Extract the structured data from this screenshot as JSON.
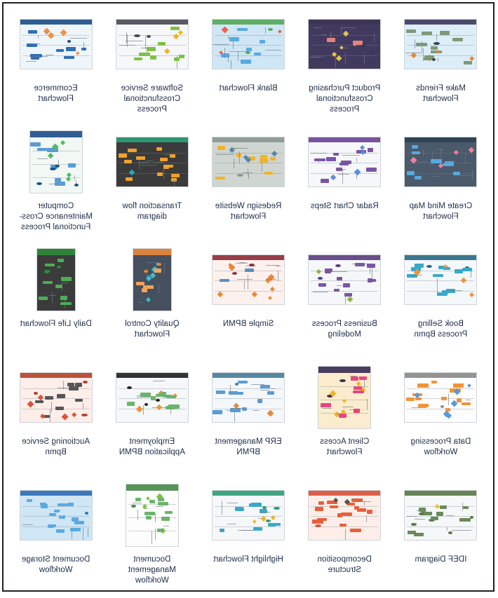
{
  "gallery": {
    "columns": 5,
    "rows": 5,
    "label_color": "#1b2a47",
    "border_color": "#231f20",
    "templates": [
      {
        "id": "make-friends-flowchart",
        "label": "Make Friends Flowchart",
        "shape": "landscape",
        "bg": "bg-lightblue",
        "accent": "#7e9a77",
        "accent2": "#e8893a",
        "dark": "#3f3a5e"
      },
      {
        "id": "product-purchasing-crossfunctional",
        "label": "Product Purchasing Crossfunctional Process",
        "shape": "landscape",
        "bg": "bg-navy",
        "accent": "#e8837a",
        "accent2": "#e8c44a",
        "dark": "#3a3456"
      },
      {
        "id": "blank-flowchart",
        "label": "Blank Flowchart",
        "shape": "landscape",
        "bg": "bg-skyblue",
        "accent": "#5aa9e0",
        "accent2": "#e8634a",
        "dark": "#57a85b"
      },
      {
        "id": "software-service-crossfunctional",
        "label": "Software Service Crossfunctional Process",
        "shape": "landscape",
        "bg": "bg-offwhite",
        "accent": "#7dc242",
        "accent2": "#f0b429",
        "dark": "#4b4b57"
      },
      {
        "id": "ecommerce-flowchart",
        "label": "Ecommerce Flowchart",
        "shape": "landscape",
        "bg": "bg-paleblue",
        "accent": "#2f6fb5",
        "accent2": "#f0924a",
        "dark": "#1e4f87"
      },
      {
        "id": "create-mind-map-flowchart",
        "label": "Create Mind Map Flowchart",
        "shape": "landscape",
        "bg": "bg-slate",
        "accent": "#58a8dd",
        "accent2": "#ef7ea0",
        "dark": "#2f4255"
      },
      {
        "id": "radar-chart-steps",
        "label": "Radar Chart Steps",
        "shape": "landscape",
        "bg": "bg-offwhite",
        "accent": "#7b55a3",
        "accent2": "#5c8fd6",
        "dark": "#6a4596"
      },
      {
        "id": "redesign-website-flowchart",
        "label": "Redesign Website Flowchart",
        "shape": "landscape",
        "bg": "bg-grey",
        "accent": "#f0b429",
        "accent2": "#5a86a8",
        "dark": "#8a9a92"
      },
      {
        "id": "transaction-flow-diagram",
        "label": "Transaction flow diagram",
        "shape": "landscape",
        "bg": "bg-dark",
        "accent": "#f0a32a",
        "accent2": "#2fa5c0",
        "dark": "#2f9e78"
      },
      {
        "id": "computer-maintenance-crossfunctional",
        "label": "Computer Maintenance Cross-Functional Process",
        "shape": "tallish",
        "bg": "bg-mint",
        "accent": "#5a9bd5",
        "accent2": "#52b86a",
        "dark": "#1f4f8a"
      },
      {
        "id": "book-selling-process-bpmn",
        "label": "Book Selling Process Bpmn",
        "shape": "landscape",
        "bg": "bg-ice",
        "accent": "#3aa8c8",
        "accent2": "#f0943a",
        "dark": "#2a6c86"
      },
      {
        "id": "business-process-modeling",
        "label": "Business Process Modeling",
        "shape": "landscape",
        "bg": "bg-offwhite",
        "accent": "#7b55a3",
        "accent2": "#8cb63a",
        "dark": "#5d3f80"
      },
      {
        "id": "simple-bpmn",
        "label": "Simple BPMN",
        "shape": "landscape",
        "bg": "bg-palepink",
        "accent": "#5a8ec0",
        "accent2": "#e8893a",
        "dark": "#8f2f3a"
      },
      {
        "id": "quality-control-flowchart",
        "label": "Quality Control Flowchart",
        "shape": "portrait",
        "bg": "bg-darkslate",
        "accent": "#f0a356",
        "accent2": "#3fbecf",
        "dark": "#e8883a"
      },
      {
        "id": "daily-life-flowchart",
        "label": "Daily Life Flowchart",
        "shape": "portrait",
        "bg": "bg-dark",
        "accent": "#4cae53",
        "accent2": "#cfcfcf",
        "dark": "#2f8a3a"
      },
      {
        "id": "data-processing-workflow",
        "label": "Data Processing Workflow",
        "shape": "landscape",
        "bg": "bg-white",
        "accent": "#f0943a",
        "accent2": "#5a9bd5",
        "dark": "#8a8a8a"
      },
      {
        "id": "client-access-flowchart",
        "label": "Client Access Flowchart",
        "shape": "tallish",
        "bg": "bg-cream",
        "accent": "#e8457e",
        "accent2": "#f0b429",
        "dark": "#3a2f56"
      },
      {
        "id": "erp-management-bpmn",
        "label": "ERP Management BPMN",
        "shape": "landscape",
        "bg": "bg-ice",
        "accent": "#5a9bd5",
        "accent2": "#e8893a",
        "dark": "#4a7f9a"
      },
      {
        "id": "employment-application-bpmn",
        "label": "Employment Application BPMN",
        "shape": "landscape",
        "bg": "bg-offwhite",
        "accent": "#6cb36c",
        "accent2": "#f0943a",
        "dark": "#222222"
      },
      {
        "id": "auctioning-service-bpmn",
        "label": "Auctioning Service Bpmn",
        "shape": "landscape",
        "bg": "bg-peach",
        "accent": "#565656",
        "accent2": "#d9543a",
        "dark": "#b5432f"
      },
      {
        "id": "idef-diagram",
        "label": "IDEF Diagram",
        "shape": "landscape",
        "bg": "bg-offwhite",
        "accent": "#6b8a5a",
        "accent2": "#f0c429",
        "dark": "#5a7a4a"
      },
      {
        "id": "decomposition-structure",
        "label": "Decomposition Structure",
        "shape": "landscape",
        "bg": "bg-peach",
        "accent": "#e8603a",
        "accent2": "#565656",
        "dark": "#d9543a"
      },
      {
        "id": "highlight-flowchart",
        "label": "Highlight Flowchart",
        "shape": "landscape",
        "bg": "bg-offwhite",
        "accent": "#3aa8c8",
        "accent2": "#f0b429",
        "dark": "#2f9e78"
      },
      {
        "id": "document-management-workflow",
        "label": "Document Management Workflow",
        "shape": "tallish",
        "bg": "bg-white",
        "accent": "#6cb36c",
        "accent2": "#7dc242",
        "dark": "#4a8a4a"
      },
      {
        "id": "document-storage-workflow",
        "label": "Document Storage Workflow",
        "shape": "landscape",
        "bg": "bg-skyblue",
        "accent": "#5aa9e0",
        "accent2": "#cfe6f5",
        "dark": "#2f6fb5"
      }
    ]
  }
}
